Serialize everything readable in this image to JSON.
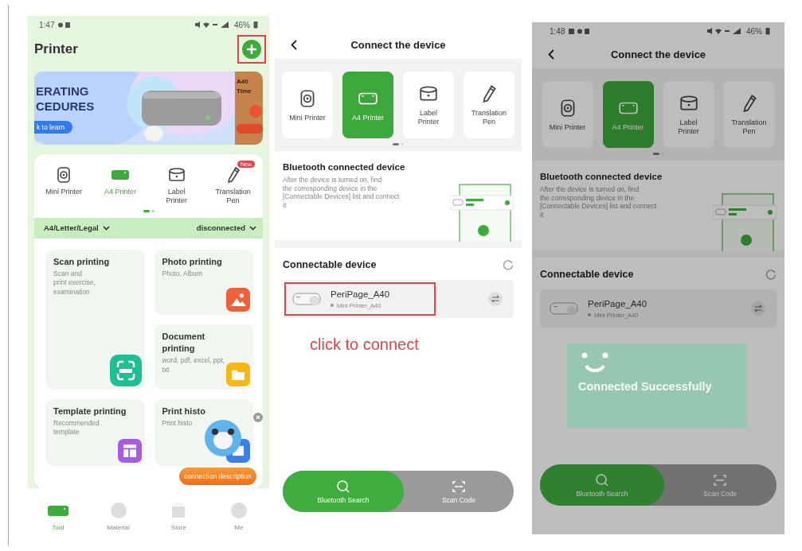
{
  "home_screen": {
    "status_bar": {
      "time": "1:47",
      "battery": "46%"
    },
    "title": "Printer",
    "add_button": {
      "highlighted": true
    },
    "banner": {
      "headline": [
        "ERATING",
        "CEDURES"
      ],
      "button": "k to learn",
      "side_text": [
        "A40",
        "Time"
      ]
    },
    "device_types": [
      {
        "label": "Mini Printer",
        "selected": false
      },
      {
        "label": "A4 Printer",
        "selected": true
      },
      {
        "label": "Label\nPrinter",
        "selected": false
      },
      {
        "label": "Translation\nPen",
        "selected": false,
        "badge": "New"
      }
    ],
    "paper_size": "A4/Letter/Legal",
    "connection_status": "disconnected",
    "features": [
      {
        "title": "Scan printing",
        "subtitle": "Scan and\nprint exercise,\nexamination"
      },
      {
        "title": "Photo printing",
        "subtitle": "Photo, Album"
      },
      {
        "title": "Document\nprinting",
        "subtitle": "word, pdf, excel, ppt,\ntxt"
      },
      {
        "title": "Template printing",
        "subtitle": "Recommended\ntemplate"
      },
      {
        "title": "Print histo",
        "subtitle": "Print histo"
      }
    ],
    "floating_help": "connection description",
    "nav": [
      {
        "label": "Tool",
        "selected": true
      },
      {
        "label": "Material",
        "selected": false
      },
      {
        "label": "Store",
        "selected": false
      },
      {
        "label": "Me",
        "selected": false
      }
    ]
  },
  "connect_screens": [
    {
      "title": "Connect the device",
      "dimmed": false,
      "device_types": [
        {
          "label": "Mini Printer",
          "selected": false
        },
        {
          "label": "A4 Printer",
          "selected": true
        },
        {
          "label": "Label\nPrinter",
          "selected": false
        },
        {
          "label": "Translation\nPen",
          "selected": false
        }
      ],
      "guide": {
        "heading": "Bluetooth connected device",
        "text": "After the device is turned on, find\nthe corresponding device in the\n[Connectable Devices] list and connect\nit"
      },
      "list_heading": "Connectable device",
      "devices": [
        {
          "name": "PeriPage_A40",
          "model": "Mini Printer_A40",
          "highlighted": true
        }
      ],
      "callout": "click to connect",
      "bottom_tabs": [
        {
          "label": "Bluetooth Search",
          "selected": true
        },
        {
          "label": "Scan Code",
          "selected": false
        }
      ]
    },
    {
      "status_bar": {
        "time": "1:48",
        "battery": "46%"
      },
      "title": "Connect the device",
      "dimmed": true,
      "device_types": [
        {
          "label": "Mini Printer",
          "selected": false
        },
        {
          "label": "A4 Printer",
          "selected": true
        },
        {
          "label": "Label\nPrinter",
          "selected": false
        },
        {
          "label": "Translation\nPen",
          "selected": false
        }
      ],
      "guide": {
        "heading": "Bluetooth connected device",
        "text": "After the device is turned on, find\nthe corresponding device in the\n[Connectable Devices] list and connect\nit"
      },
      "list_heading": "Connectable device",
      "devices": [
        {
          "name": "PeriPage_A40",
          "model": "Mini Printer_A40",
          "highlighted": false
        }
      ],
      "bottom_tabs": [
        {
          "label": "Bluetooth Search",
          "selected": true
        },
        {
          "label": "Scan Code",
          "selected": false
        }
      ],
      "toast": "Connected Successfully"
    }
  ]
}
